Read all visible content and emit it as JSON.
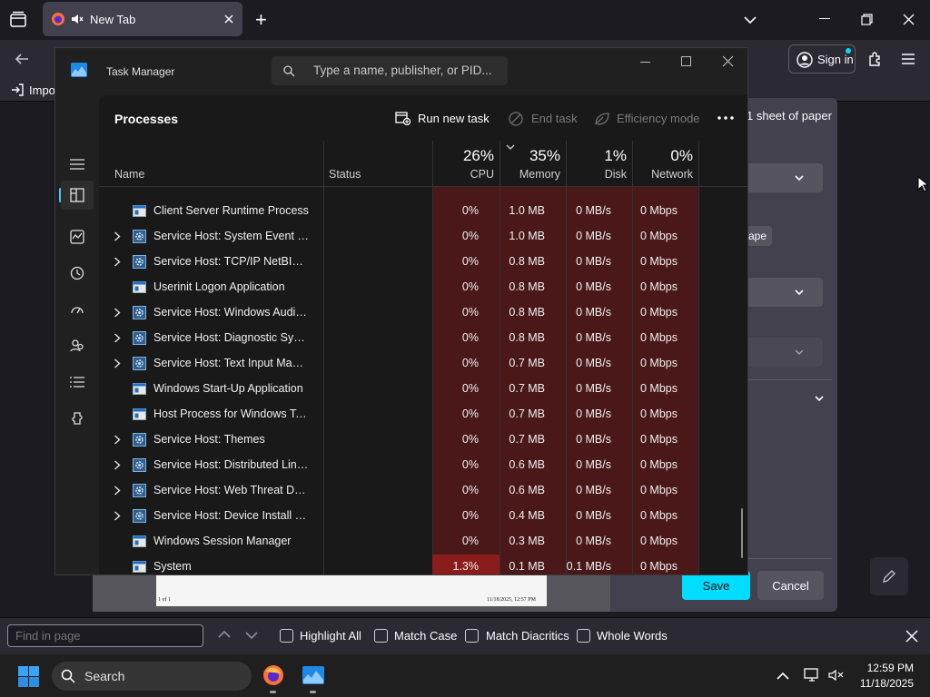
{
  "browser": {
    "tab_title": "New Tab",
    "new_tab_label": "+",
    "sign_in_label": "Sign in",
    "bookmark_import_label": "Impo",
    "colors": {
      "bg": "#1c1b22",
      "toolbar": "#2b2a33",
      "tab": "#42414d"
    }
  },
  "print_dialog": {
    "sheets_label": "1 sheet of paper",
    "orientation_partial": "ape",
    "save_label": "Save",
    "cancel_label": "Cancel",
    "preview_footer_left": "1 of 1",
    "preview_footer_right": "11/18/2025, 12:57 PM"
  },
  "findbar": {
    "placeholder": "Find in page",
    "highlight_all": "Highlight All",
    "match_case": "Match Case",
    "match_diacritics": "Match Diacritics",
    "whole_words": "Whole Words"
  },
  "taskbar": {
    "search_label": "Search",
    "time": "12:59 PM",
    "date": "11/18/2025"
  },
  "taskmanager": {
    "title": "Task Manager",
    "search_placeholder": "Type a name, publisher, or PID...",
    "page_title": "Processes",
    "actions": {
      "run_new_task": "Run new task",
      "end_task": "End task",
      "efficiency_mode": "Efficiency mode"
    },
    "columns": {
      "name": "Name",
      "status": "Status",
      "cpu_pct": "26%",
      "cpu": "CPU",
      "memory_pct": "35%",
      "memory": "Memory",
      "disk_pct": "1%",
      "disk": "Disk",
      "network_pct": "0%",
      "network": "Network"
    },
    "rows": [
      {
        "name": "Client Server Runtime Process",
        "expandable": false,
        "icon": "window-icon",
        "cpu": "0%",
        "memory": "1.0 MB",
        "disk": "0 MB/s",
        "network": "0 Mbps"
      },
      {
        "name": "Service Host: System Event No...",
        "expandable": true,
        "icon": "gear-icon",
        "cpu": "0%",
        "memory": "1.0 MB",
        "disk": "0 MB/s",
        "network": "0 Mbps"
      },
      {
        "name": "Service Host: TCP/IP NetBIOS ...",
        "expandable": true,
        "icon": "gear-icon",
        "cpu": "0%",
        "memory": "0.8 MB",
        "disk": "0 MB/s",
        "network": "0 Mbps"
      },
      {
        "name": "Userinit Logon Application",
        "expandable": false,
        "icon": "window-icon",
        "cpu": "0%",
        "memory": "0.8 MB",
        "disk": "0 MB/s",
        "network": "0 Mbps"
      },
      {
        "name": "Service Host: Windows Audio ...",
        "expandable": true,
        "icon": "gear-icon",
        "cpu": "0%",
        "memory": "0.8 MB",
        "disk": "0 MB/s",
        "network": "0 Mbps"
      },
      {
        "name": "Service Host: Diagnostic Syste...",
        "expandable": true,
        "icon": "gear-icon",
        "cpu": "0%",
        "memory": "0.8 MB",
        "disk": "0 MB/s",
        "network": "0 Mbps"
      },
      {
        "name": "Service Host: Text Input Mana...",
        "expandable": true,
        "icon": "gear-icon",
        "cpu": "0%",
        "memory": "0.7 MB",
        "disk": "0 MB/s",
        "network": "0 Mbps"
      },
      {
        "name": "Windows Start-Up Application",
        "expandable": false,
        "icon": "window-icon",
        "cpu": "0%",
        "memory": "0.7 MB",
        "disk": "0 MB/s",
        "network": "0 Mbps"
      },
      {
        "name": "Host Process for Windows Tasks",
        "expandable": false,
        "icon": "window-icon",
        "cpu": "0%",
        "memory": "0.7 MB",
        "disk": "0 MB/s",
        "network": "0 Mbps"
      },
      {
        "name": "Service Host: Themes",
        "expandable": true,
        "icon": "gear-icon",
        "cpu": "0%",
        "memory": "0.7 MB",
        "disk": "0 MB/s",
        "network": "0 Mbps"
      },
      {
        "name": "Service Host: Distributed Link ...",
        "expandable": true,
        "icon": "gear-icon",
        "cpu": "0%",
        "memory": "0.6 MB",
        "disk": "0 MB/s",
        "network": "0 Mbps"
      },
      {
        "name": "Service Host: Web Threat Defe...",
        "expandable": true,
        "icon": "gear-icon",
        "cpu": "0%",
        "memory": "0.6 MB",
        "disk": "0 MB/s",
        "network": "0 Mbps"
      },
      {
        "name": "Service Host: Device Install Ser...",
        "expandable": true,
        "icon": "gear-icon",
        "cpu": "0%",
        "memory": "0.4 MB",
        "disk": "0 MB/s",
        "network": "0 Mbps"
      },
      {
        "name": "Windows Session Manager",
        "expandable": false,
        "icon": "window-icon",
        "cpu": "0%",
        "memory": "0.3 MB",
        "disk": "0 MB/s",
        "network": "0 Mbps"
      },
      {
        "name": "System",
        "expandable": false,
        "icon": "window-icon",
        "cpu": "1.3%",
        "memory": "0.1 MB",
        "disk": "0.1 MB/s",
        "network": "0 Mbps",
        "cpu_highlight": true
      }
    ],
    "colors": {
      "heat": "#4a1818",
      "heat_strong": "#8a1c1c",
      "accent": "#4cc2ff"
    }
  }
}
